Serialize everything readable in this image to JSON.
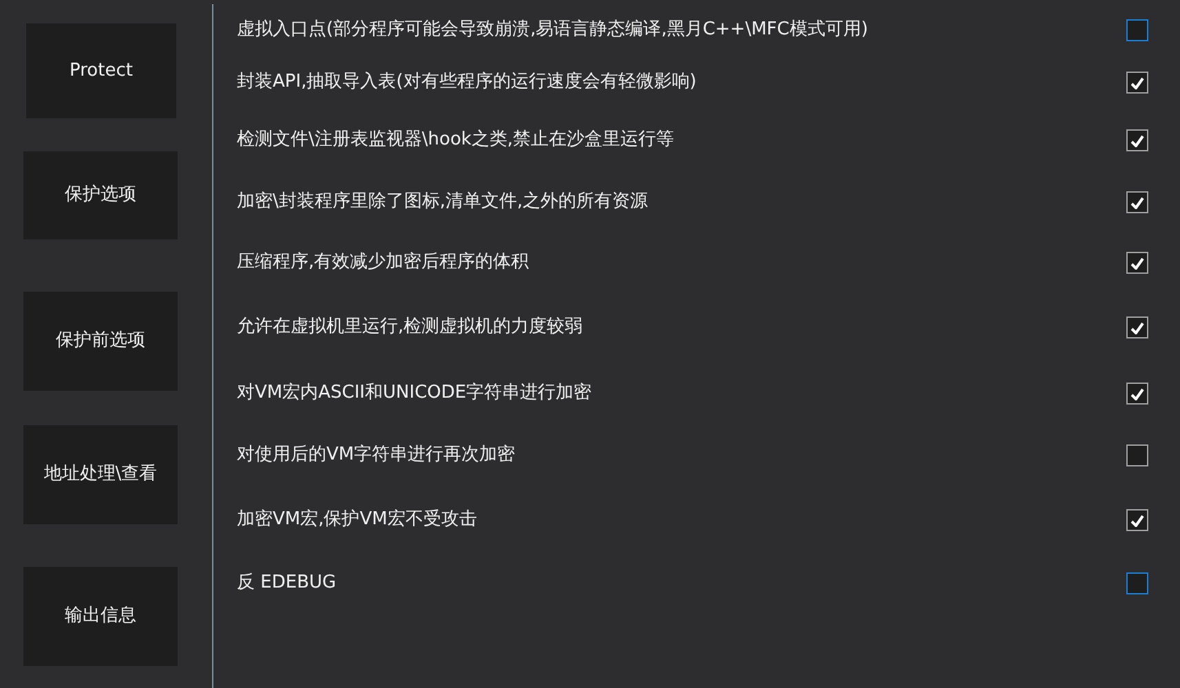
{
  "nav_buttons": [
    {
      "label": "Protect"
    },
    {
      "label": "保护选项"
    },
    {
      "label": "保护前选项"
    },
    {
      "label": "地址处理\\查看"
    },
    {
      "label": "输出信息"
    }
  ],
  "options": [
    {
      "label": "虚拟入口点(部分程序可能会导致崩溃,易语言静态编译,黑月C++\\MFC模式可用)",
      "checked": false,
      "focused": true
    },
    {
      "label": "封装API,抽取导入表(对有些程序的运行速度会有轻微影响)",
      "checked": true,
      "focused": false
    },
    {
      "label": "检测文件\\注册表监视器\\hook之类,禁止在沙盒里运行等",
      "checked": true,
      "focused": false
    },
    {
      "label": "加密\\封装程序里除了图标,清单文件,之外的所有资源",
      "checked": true,
      "focused": false
    },
    {
      "label": "压缩程序,有效减少加密后程序的体积",
      "checked": true,
      "focused": false
    },
    {
      "label": "允许在虚拟机里运行,检测虚拟机的力度较弱",
      "checked": true,
      "focused": false
    },
    {
      "label": "对VM宏内ASCII和UNICODE字符串进行加密",
      "checked": true,
      "focused": false
    },
    {
      "label": "对使用后的VM字符串进行再次加密",
      "checked": false,
      "focused": false
    },
    {
      "label": "加密VM宏,保护VM宏不受攻击",
      "checked": true,
      "focused": false
    },
    {
      "label": "反 EDEBUG",
      "checked": false,
      "focused": true
    }
  ]
}
